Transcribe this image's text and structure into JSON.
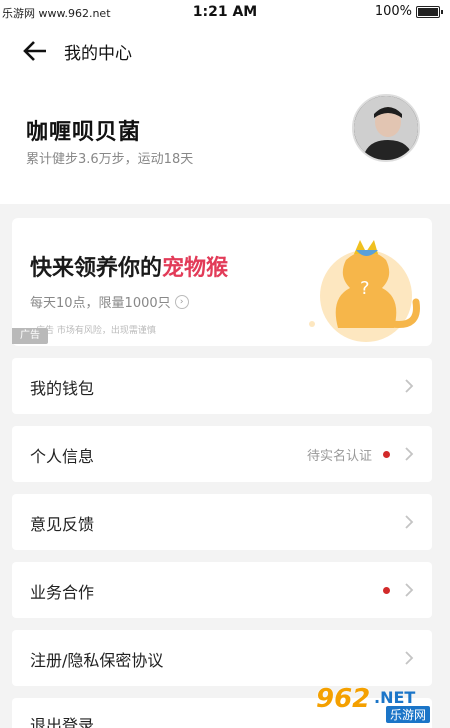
{
  "status_bar": {
    "watermark": "乐游网 www.962.net",
    "time": "1:21 AM",
    "battery_text": "100%"
  },
  "header": {
    "title": "我的中心",
    "user_name": "咖喱呗贝菌",
    "stats": "累计健步3.6万步，运动18天"
  },
  "ad": {
    "title_prefix": "快来领养你的",
    "title_highlight": "宠物猴",
    "subtitle": "每天10点，限量1000只",
    "fine_print": "广告 市场有风险，出现需谨慎",
    "badge": "广告",
    "colors": {
      "highlight": "#e23b58",
      "monkey": "#f6b64a"
    }
  },
  "menu": {
    "items": [
      {
        "label": "我的钱包",
        "status": "",
        "dot": false
      },
      {
        "label": "个人信息",
        "status": "待实名认证",
        "dot": true
      },
      {
        "label": "意见反馈",
        "status": "",
        "dot": false
      },
      {
        "label": "业务合作",
        "status": "",
        "dot": true
      },
      {
        "label": "注册/隐私保密协议",
        "status": "",
        "dot": false
      },
      {
        "label": "退出登录",
        "status": "",
        "dot": false
      }
    ]
  },
  "watermark_bottom": {
    "number": "962",
    "net": ".NET",
    "cn": "乐游网"
  },
  "colors": {
    "background": "#f3f3f3",
    "card": "#ffffff",
    "red_dot": "#d22a2a"
  }
}
